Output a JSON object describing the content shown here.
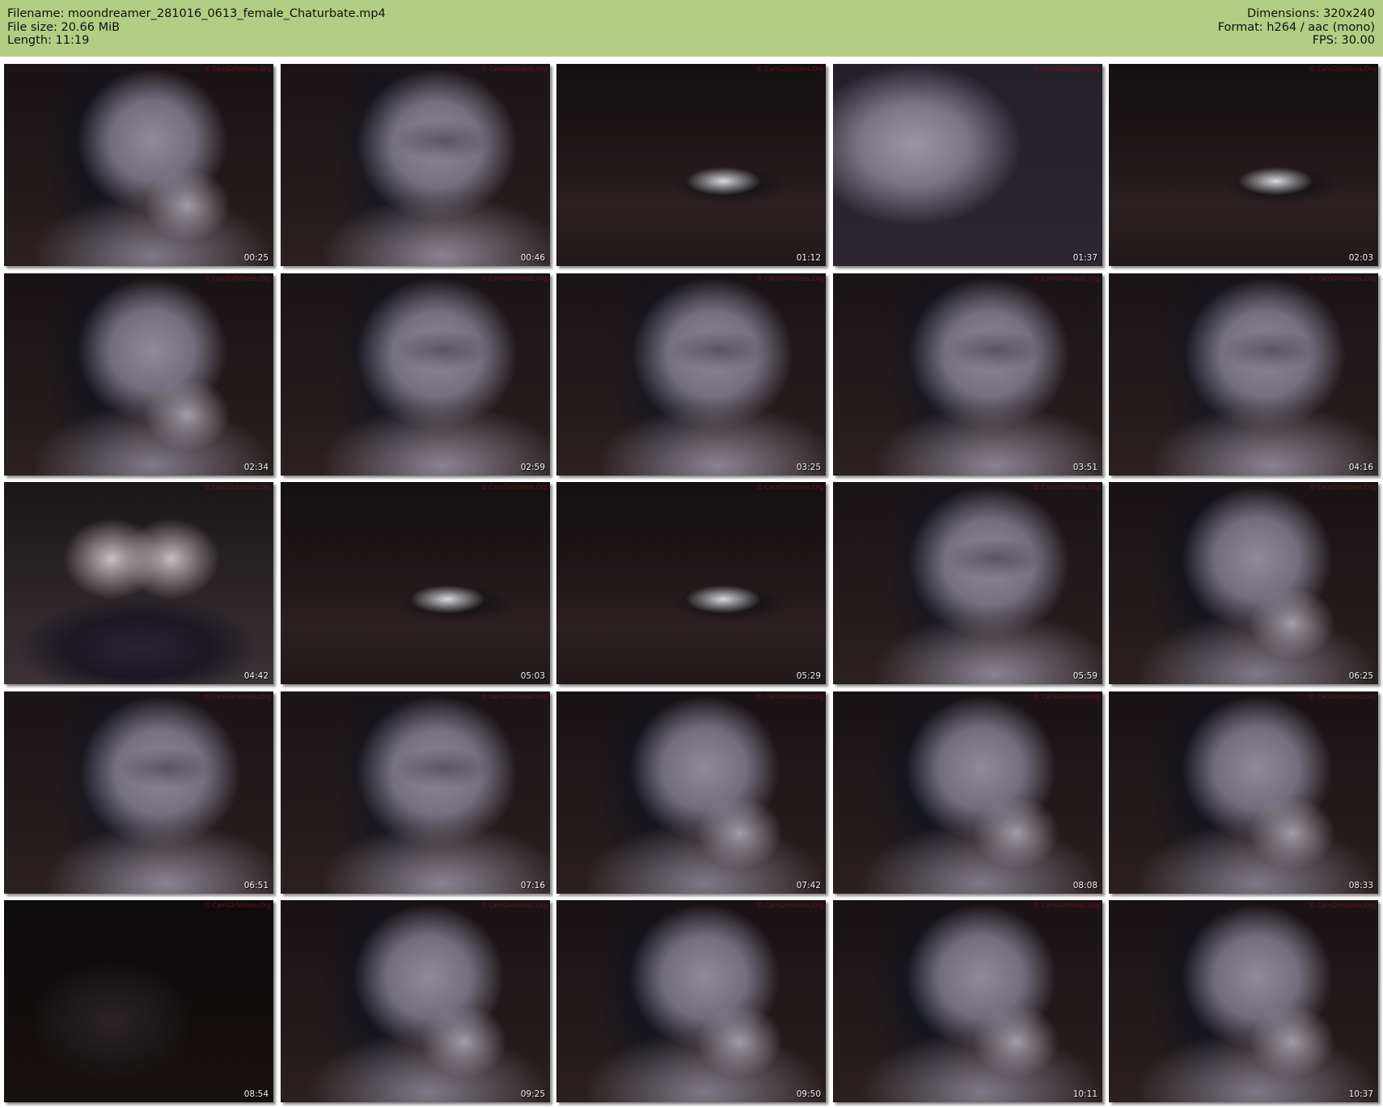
{
  "header": {
    "filename_label": "Filename:",
    "filename": "moondreamer_281016_0613_female_Chaturbate.mp4",
    "filesize_label": "File size:",
    "filesize": "20.66 MiB",
    "length_label": "Length:",
    "length": "11:19",
    "dimensions_label": "Dimensions:",
    "dimensions": "320x240",
    "format_label": "Format:",
    "format": "h264 / aac (mono)",
    "fps_label": "FPS:",
    "fps": "30.00"
  },
  "watermark": "© CamGirlVideos.Org",
  "thumbnails": [
    {
      "time": "00:25",
      "scene": "hand"
    },
    {
      "time": "00:46",
      "scene": "face"
    },
    {
      "time": "01:12",
      "scene": "couch"
    },
    {
      "time": "01:37",
      "scene": "blur"
    },
    {
      "time": "02:03",
      "scene": "couch"
    },
    {
      "time": "02:34",
      "scene": "hand"
    },
    {
      "time": "02:59",
      "scene": "face"
    },
    {
      "time": "03:25",
      "scene": "face"
    },
    {
      "time": "03:51",
      "scene": "face"
    },
    {
      "time": "04:16",
      "scene": "face"
    },
    {
      "time": "04:42",
      "scene": "chest"
    },
    {
      "time": "05:03",
      "scene": "couch"
    },
    {
      "time": "05:29",
      "scene": "couch"
    },
    {
      "time": "05:59",
      "scene": "face"
    },
    {
      "time": "06:25",
      "scene": "hand"
    },
    {
      "time": "06:51",
      "scene": "face"
    },
    {
      "time": "07:16",
      "scene": "face"
    },
    {
      "time": "07:42",
      "scene": "hand"
    },
    {
      "time": "08:08",
      "scene": "hand"
    },
    {
      "time": "08:33",
      "scene": "hand"
    },
    {
      "time": "08:54",
      "scene": "dark"
    },
    {
      "time": "09:25",
      "scene": "hand"
    },
    {
      "time": "09:50",
      "scene": "hand"
    },
    {
      "time": "10:11",
      "scene": "hand"
    },
    {
      "time": "10:37",
      "scene": "hand"
    }
  ]
}
